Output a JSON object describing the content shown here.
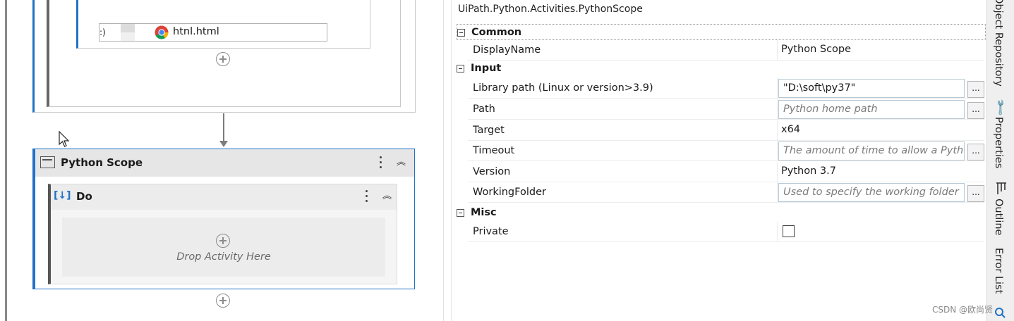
{
  "designer": {
    "file_label": "htnl.html",
    "file_prefix": ":)",
    "scope_title": "Python Scope",
    "do_title": "Do",
    "drop_hint": "Drop Activity Here",
    "do_icon": "[↓]"
  },
  "properties": {
    "title": "UiPath.Python.Activities.PythonScope",
    "categories": {
      "common": "Common",
      "input": "Input",
      "misc": "Misc"
    },
    "rows": {
      "displayname": {
        "name": "DisplayName",
        "value": "Python Scope"
      },
      "library_path": {
        "name": "Library path (Linux or version>3.9)",
        "value": "\"D:\\soft\\py37\""
      },
      "path": {
        "name": "Path",
        "placeholder": "Python home path"
      },
      "target": {
        "name": "Target",
        "value": "x64"
      },
      "timeout": {
        "name": "Timeout",
        "placeholder": "The amount of time to allow a Pyth"
      },
      "version": {
        "name": "Version",
        "value": "Python 3.7"
      },
      "workingfolder": {
        "name": "WorkingFolder",
        "placeholder": "Used to specify the working folder"
      },
      "private": {
        "name": "Private",
        "checked": false
      }
    },
    "ellipsis": "..."
  },
  "dock": {
    "tabs": [
      "Object Repository",
      "Properties",
      "Outline",
      "Error List"
    ]
  },
  "watermark": "CSDN @欧尚贤"
}
